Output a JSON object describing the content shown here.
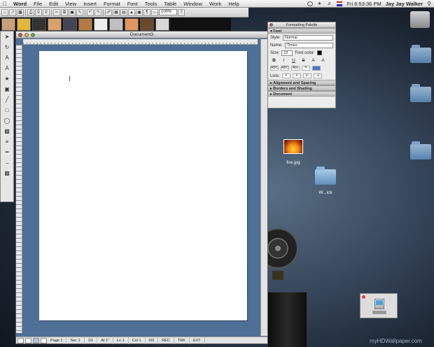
{
  "menubar": {
    "app": "Word",
    "items": [
      "File",
      "Edit",
      "View",
      "Insert",
      "Format",
      "Font",
      "Tools",
      "Table",
      "Window",
      "Work",
      "Help"
    ],
    "clock": "Fri 6:53:36 PM",
    "user": "Jay Jay Walker"
  },
  "toolbar": {
    "zoom": "100%"
  },
  "document": {
    "title": "Document3",
    "status": {
      "page": "Page",
      "page_num": "1",
      "sec": "Sec",
      "sec_num": "1",
      "pages": "1/1",
      "at": "At",
      "at_val": "1\"",
      "ln": "Ln",
      "ln_num": "1",
      "col": "Col",
      "col_num": "1",
      "words": "0/0",
      "rec": "REC",
      "trk": "TRK",
      "ext": "EXT"
    }
  },
  "formatting_palette": {
    "title": "Formatting Palette",
    "font_section": "Font",
    "style_label": "Style:",
    "style_value": "Normal",
    "name_label": "Name:",
    "name_value": "Times",
    "size_label": "Size:",
    "size_value": "12",
    "font_color_label": "Font color:",
    "font_color": "#000000",
    "buttons": [
      "B",
      "I",
      "U",
      "S",
      "A",
      "A"
    ],
    "small_buttons": [
      "ABC",
      "ABC",
      "Abc"
    ],
    "lists_label": "Lists:",
    "collapsed_sections": [
      "Alignment and Spacing",
      "Borders and Shading",
      "Document"
    ]
  },
  "desktop": {
    "icons": [
      {
        "label": "fire.jpg"
      },
      {
        "label": "W...ick"
      }
    ],
    "watermark": "myHDWallpaper.com"
  }
}
